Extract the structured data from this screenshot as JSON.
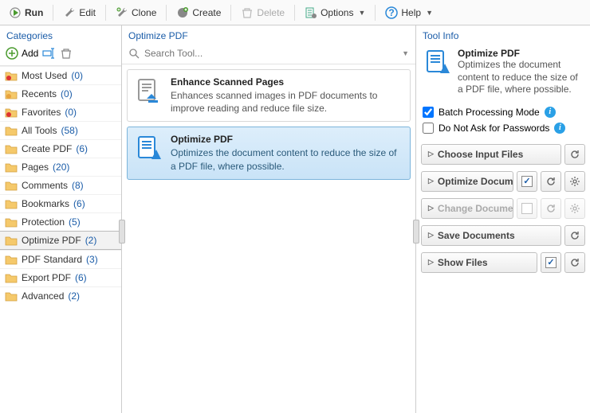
{
  "toolbar": {
    "run": "Run",
    "edit": "Edit",
    "clone": "Clone",
    "create": "Create",
    "delete": "Delete",
    "options": "Options",
    "help": "Help"
  },
  "categories": {
    "title": "Categories",
    "add": "Add",
    "items": [
      {
        "label": "Most Used",
        "count": "(0)",
        "star": true,
        "red": true
      },
      {
        "label": "Recents",
        "count": "(0)",
        "star": true
      },
      {
        "label": "Favorites",
        "count": "(0)",
        "star": true,
        "red": true
      },
      {
        "label": "All Tools",
        "count": "(58)"
      },
      {
        "label": "Create PDF",
        "count": "(6)"
      },
      {
        "label": "Pages",
        "count": "(20)"
      },
      {
        "label": "Comments",
        "count": "(8)"
      },
      {
        "label": "Bookmarks",
        "count": "(6)"
      },
      {
        "label": "Protection",
        "count": "(5)"
      },
      {
        "label": "Optimize PDF",
        "count": "(2)",
        "selected": true
      },
      {
        "label": "PDF Standard",
        "count": "(3)"
      },
      {
        "label": "Export PDF",
        "count": "(6)"
      },
      {
        "label": "Advanced",
        "count": "(2)"
      }
    ]
  },
  "mid": {
    "title": "Optimize PDF",
    "search_placeholder": "Search Tool...",
    "tools": [
      {
        "title": "Enhance Scanned Pages",
        "desc": "Enhances scanned images in PDF documents to improve reading and reduce file size."
      },
      {
        "title": "Optimize PDF",
        "desc": "Optimizes the document content to reduce the size of a PDF file, where possible.",
        "selected": true
      }
    ]
  },
  "info": {
    "title": "Tool Info",
    "tool_title": "Optimize PDF",
    "tool_desc": "Optimizes the document content to reduce the size of a PDF file, where possible.",
    "batch_mode": "Batch Processing Mode",
    "no_passwords": "Do Not Ask for Passwords",
    "steps": [
      {
        "label": "Choose Input Files",
        "reset": true
      },
      {
        "label": "Optimize Document",
        "check": true,
        "reset": true,
        "gear": true
      },
      {
        "label": "Change Document ..",
        "check": false,
        "reset": true,
        "gear": true,
        "disabled": true
      },
      {
        "label": "Save Documents",
        "reset": true
      },
      {
        "label": "Show Files",
        "check": true,
        "reset": true
      }
    ]
  }
}
